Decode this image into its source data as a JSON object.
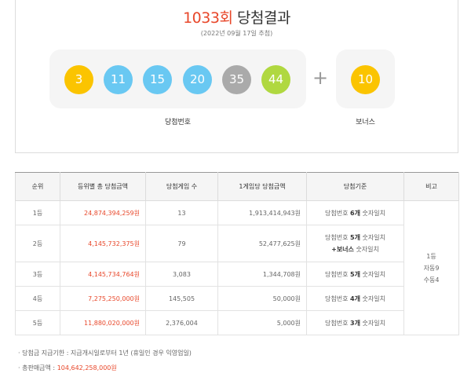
{
  "header": {
    "round": "1033회",
    "title_suffix": " 당첨결과",
    "draw_date": "(2022년 09월 17일 추첨)"
  },
  "winning": {
    "label": "당첨번호",
    "balls": [
      {
        "number": "3",
        "color": "#fbc400"
      },
      {
        "number": "11",
        "color": "#69c8f2"
      },
      {
        "number": "15",
        "color": "#69c8f2"
      },
      {
        "number": "20",
        "color": "#69c8f2"
      },
      {
        "number": "35",
        "color": "#aaaaaa"
      },
      {
        "number": "44",
        "color": "#b0d840"
      }
    ],
    "plus": "+",
    "bonus": {
      "number": "10",
      "color": "#fbc400"
    },
    "bonus_label": "보너스"
  },
  "table": {
    "headers": [
      "순위",
      "등위별 총 당첨금액",
      "당첨게임 수",
      "1게임당 당첨금액",
      "당첨기준",
      "비고"
    ],
    "rows": [
      {
        "rank": "1등",
        "total": "24,874,394,259원",
        "games": "13",
        "per_game": "1,913,414,943원",
        "crit_pre": "당첨번호 ",
        "crit_bold": "6개",
        "crit_post": " 숫자일치",
        "crit_line2": ""
      },
      {
        "rank": "2등",
        "total": "4,145,732,375원",
        "games": "79",
        "per_game": "52,477,625원",
        "crit_pre": "당첨번호 ",
        "crit_bold": "5개",
        "crit_post": " 숫자일치",
        "crit_line2_bold": "+보너스",
        "crit_line2_post": " 숫자일치"
      },
      {
        "rank": "3등",
        "total": "4,145,734,764원",
        "games": "3,083",
        "per_game": "1,344,708원",
        "crit_pre": "당첨번호 ",
        "crit_bold": "5개",
        "crit_post": " 숫자일치"
      },
      {
        "rank": "4등",
        "total": "7,275,250,000원",
        "games": "145,505",
        "per_game": "50,000원",
        "crit_pre": "당첨번호 ",
        "crit_bold": "4개",
        "crit_post": " 숫자일치"
      },
      {
        "rank": "5등",
        "total": "11,880,020,000원",
        "games": "2,376,004",
        "per_game": "5,000원",
        "crit_pre": "당첨번호 ",
        "crit_bold": "3개",
        "crit_post": " 숫자일치"
      }
    ],
    "note": {
      "line1": "1등",
      "line2": "자동9",
      "line3": "수동4"
    }
  },
  "notes": {
    "bullet": "·",
    "deadline": "당첨금 지급기한 : 지급개시일로부터 1년 (휴일인 경우 익영업일)",
    "sales_label": "총판매금액 : ",
    "sales_value": "104,642,258,000원"
  }
}
